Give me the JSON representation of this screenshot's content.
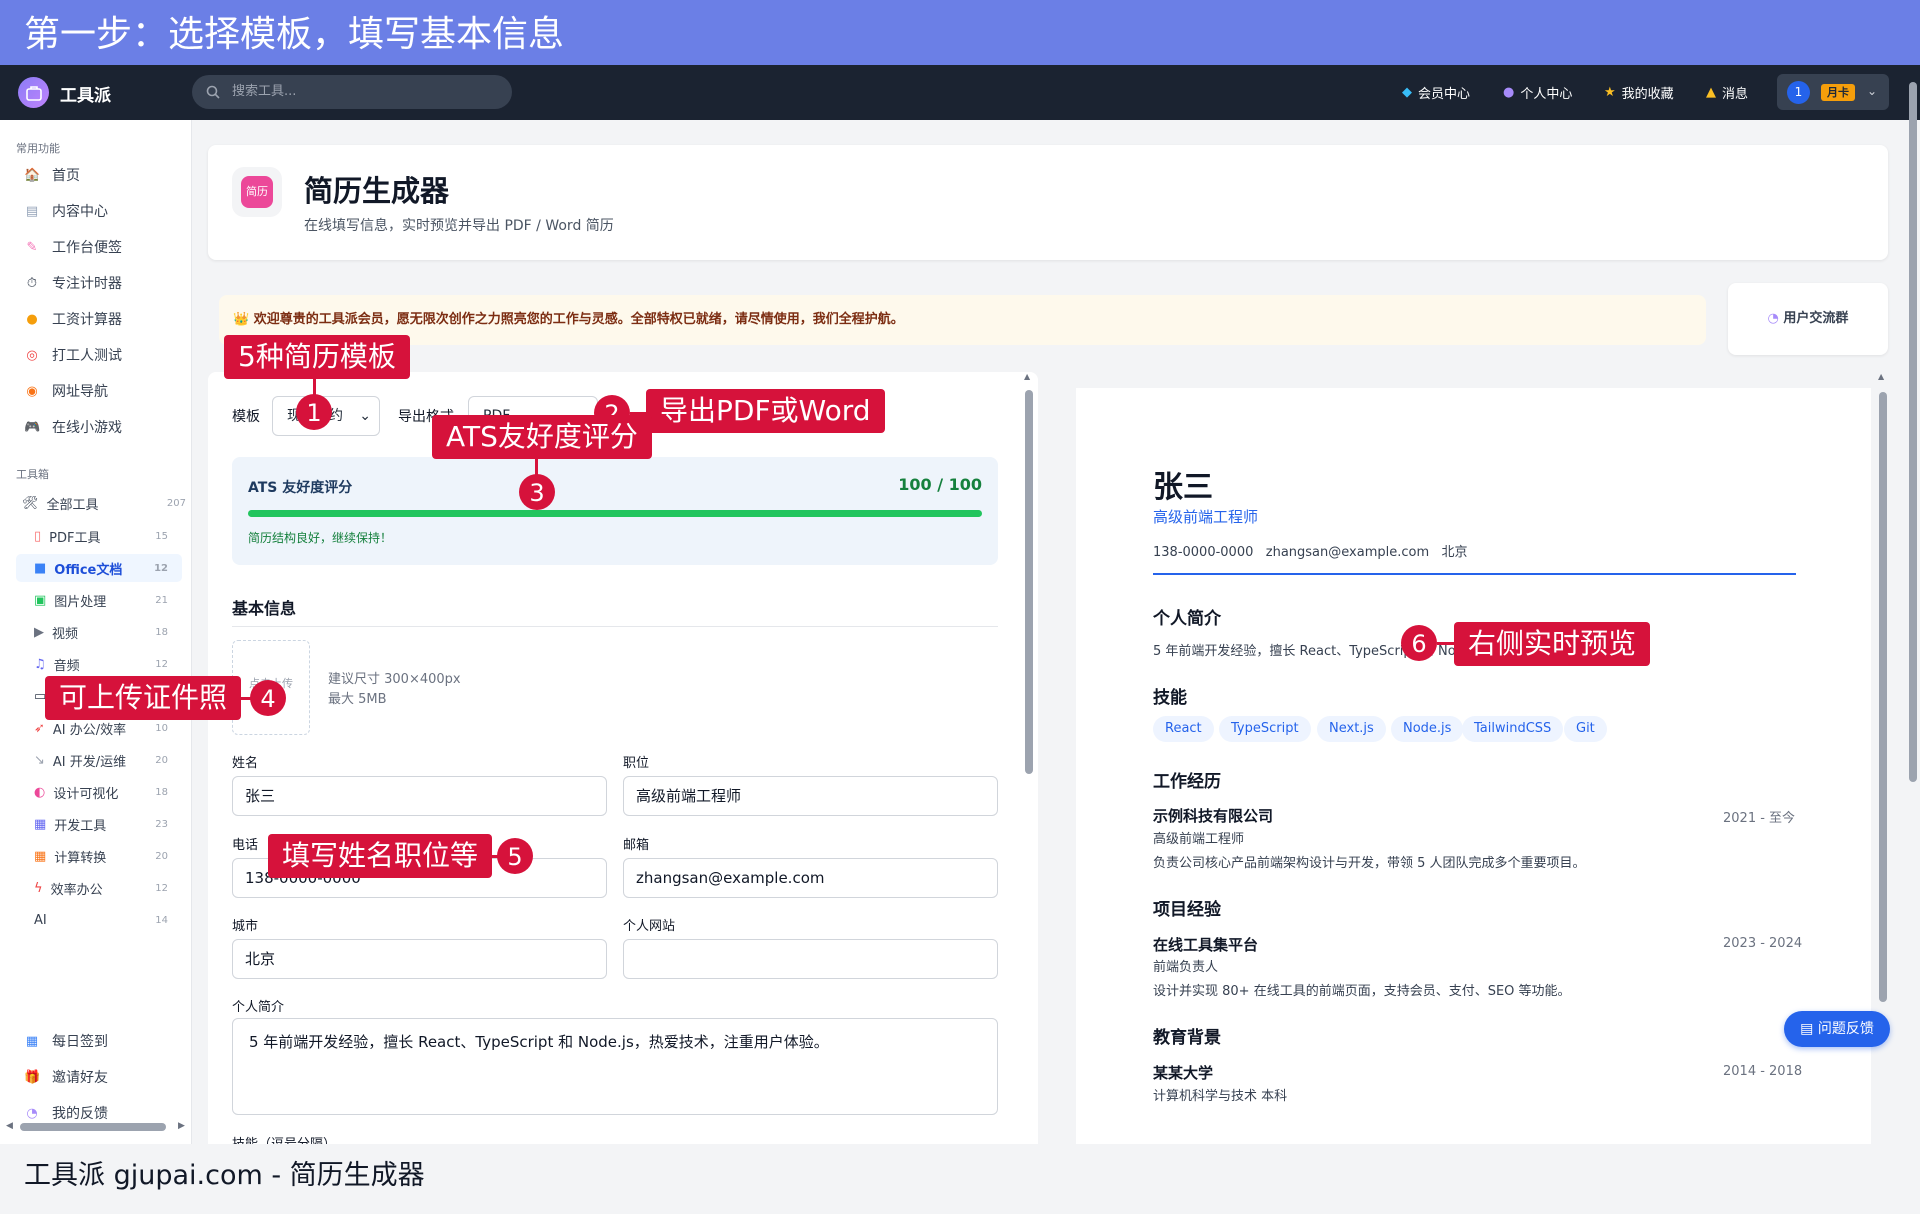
{
  "banner": "第一步：选择模板，填写基本信息",
  "topbar": {
    "logo": "工具派",
    "search_placeholder": "搜索工具...",
    "nav": [
      "会员中心",
      "个人中心",
      "我的收藏",
      "消息"
    ],
    "user_num": "1",
    "user_badge": "月卡"
  },
  "sidebar": {
    "common_title": "常用功能",
    "common": [
      "首页",
      "内容中心",
      "工作台便签",
      "专注计时器",
      "工资计算器",
      "打工人测试",
      "网址导航",
      "在线小游戏"
    ],
    "toolbox_title": "工具箱",
    "all_tools": {
      "label": "全部工具",
      "count": "207"
    },
    "tools": [
      {
        "label": "PDF工具",
        "count": "15"
      },
      {
        "label": "Office文档",
        "count": "12"
      },
      {
        "label": "图片处理",
        "count": "21"
      },
      {
        "label": "视频",
        "count": "18"
      },
      {
        "label": "音频",
        "count": "12"
      },
      {
        "label": "",
        "count": ""
      },
      {
        "label": "AI 办公/效率",
        "count": "10"
      },
      {
        "label": "AI 开发/运维",
        "count": "20"
      },
      {
        "label": "设计可视化",
        "count": "18"
      },
      {
        "label": "开发工具",
        "count": "23"
      },
      {
        "label": "计算转换",
        "count": "20"
      },
      {
        "label": "效率办公",
        "count": "12"
      },
      {
        "label": "AI",
        "count": "14"
      }
    ],
    "bottom": [
      "每日签到",
      "邀请好友",
      "我的反馈"
    ]
  },
  "header": {
    "icon_text": "简历",
    "title": "简历生成器",
    "subtitle": "在线填写信息，实时预览并导出 PDF / Word 简历"
  },
  "welcome": "欢迎尊贵的工具派会员，愿无限次创作之力照亮您的工作与灵感。全部特权已就绪，请尽情使用，我们全程护航。",
  "community": "用户交流群",
  "form": {
    "template_label": "模板",
    "template_value": "现代简约",
    "export_label": "导出格式",
    "export_value": "PDF",
    "ats_title": "ATS 友好度评分",
    "ats_score": "100 / 100",
    "ats_progress": 1.0,
    "ats_msg": "简历结构良好，继续保持！",
    "basic_title": "基本信息",
    "photo_hint": "点击上传",
    "photo_size": "建议尺寸 300×400px",
    "photo_max": "最大 5MB",
    "name_label": "姓名",
    "name_value": "张三",
    "position_label": "职位",
    "position_value": "高级前端工程师",
    "phone_label": "电话",
    "phone_value": "138-0000-0000",
    "email_label": "邮箱",
    "email_value": "zhangsan@example.com",
    "city_label": "城市",
    "city_value": "北京",
    "website_label": "个人网站",
    "website_value": "",
    "summary_label": "个人简介",
    "summary_value": "5 年前端开发经验，擅长 React、TypeScript 和 Node.js，热爱技术，注重用户体验。",
    "skills_label": "技能（逗号分隔）"
  },
  "preview": {
    "name": "张三",
    "title": "高级前端工程师",
    "contact": "138-0000-0000   zhangsan@example.com   北京",
    "summary_h": "个人简介",
    "summary": "5 年前端开发经验，擅长 React、TypeScript 和 Node.js，热爱技术，注重用户体验。",
    "skills_h": "技能",
    "skills": [
      "React",
      "TypeScript",
      "Next.js",
      "Node.js",
      "TailwindCSS",
      "Git"
    ],
    "work_h": "工作经历",
    "work_company": "示例科技有限公司",
    "work_date": "2021 - 至今",
    "work_role": "高级前端工程师",
    "work_desc": "负责公司核心产品前端架构设计与开发，带领 5 人团队完成多个重要项目。",
    "proj_h": "项目经验",
    "proj_name": "在线工具集平台",
    "proj_date": "2023 - 2024",
    "proj_role": "前端负责人",
    "proj_desc": "设计并实现 80+ 在线工具的前端页面，支持会员、支付、SEO 等功能。",
    "edu_h": "教育背景",
    "edu_school": "某某大学",
    "edu_date": "2014 - 2018",
    "edu_major": "计算机科学与技术 本科"
  },
  "feedback_btn": "问题反馈",
  "footer": "工具派 gjupai.com - 简历生成器",
  "annotations": {
    "a1": "5种简历模板",
    "n1": "1",
    "a2": "导出PDF或Word",
    "n2": "2",
    "a3": "ATS友好度评分",
    "n3": "3",
    "a4": "可上传证件照",
    "n4": "4",
    "a5": "填写姓名职位等",
    "n5": "5",
    "a6": "右侧实时预览",
    "n6": "6"
  },
  "colors": {
    "accent": "#2563eb",
    "annotation": "#d6123b",
    "banner": "#6b7fe6",
    "topbar": "#1b2331"
  }
}
